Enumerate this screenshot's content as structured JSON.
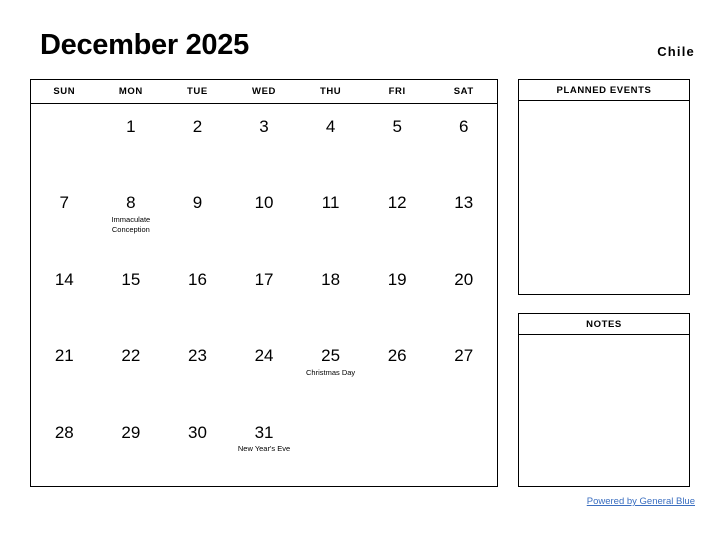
{
  "header": {
    "title": "December 2025",
    "country": "Chile"
  },
  "calendar": {
    "weekdays": [
      "SUN",
      "MON",
      "TUE",
      "WED",
      "THU",
      "FRI",
      "SAT"
    ],
    "weeks": [
      [
        {
          "day": "",
          "event": ""
        },
        {
          "day": "1",
          "event": ""
        },
        {
          "day": "2",
          "event": ""
        },
        {
          "day": "3",
          "event": ""
        },
        {
          "day": "4",
          "event": ""
        },
        {
          "day": "5",
          "event": ""
        },
        {
          "day": "6",
          "event": ""
        }
      ],
      [
        {
          "day": "7",
          "event": ""
        },
        {
          "day": "8",
          "event": "Immaculate Conception"
        },
        {
          "day": "9",
          "event": ""
        },
        {
          "day": "10",
          "event": ""
        },
        {
          "day": "11",
          "event": ""
        },
        {
          "day": "12",
          "event": ""
        },
        {
          "day": "13",
          "event": ""
        }
      ],
      [
        {
          "day": "14",
          "event": ""
        },
        {
          "day": "15",
          "event": ""
        },
        {
          "day": "16",
          "event": ""
        },
        {
          "day": "17",
          "event": ""
        },
        {
          "day": "18",
          "event": ""
        },
        {
          "day": "19",
          "event": ""
        },
        {
          "day": "20",
          "event": ""
        }
      ],
      [
        {
          "day": "21",
          "event": ""
        },
        {
          "day": "22",
          "event": ""
        },
        {
          "day": "23",
          "event": ""
        },
        {
          "day": "24",
          "event": ""
        },
        {
          "day": "25",
          "event": "Christmas Day"
        },
        {
          "day": "26",
          "event": ""
        },
        {
          "day": "27",
          "event": ""
        }
      ],
      [
        {
          "day": "28",
          "event": ""
        },
        {
          "day": "29",
          "event": ""
        },
        {
          "day": "30",
          "event": ""
        },
        {
          "day": "31",
          "event": "New Year's Eve"
        },
        {
          "day": "",
          "event": ""
        },
        {
          "day": "",
          "event": ""
        },
        {
          "day": "",
          "event": ""
        }
      ]
    ]
  },
  "panels": {
    "planned_events": {
      "title": "PLANNED EVENTS",
      "content": ""
    },
    "notes": {
      "title": "NOTES",
      "content": ""
    }
  },
  "footer": {
    "link_text": "Powered by General Blue",
    "link_color": "#3a6ec0"
  }
}
